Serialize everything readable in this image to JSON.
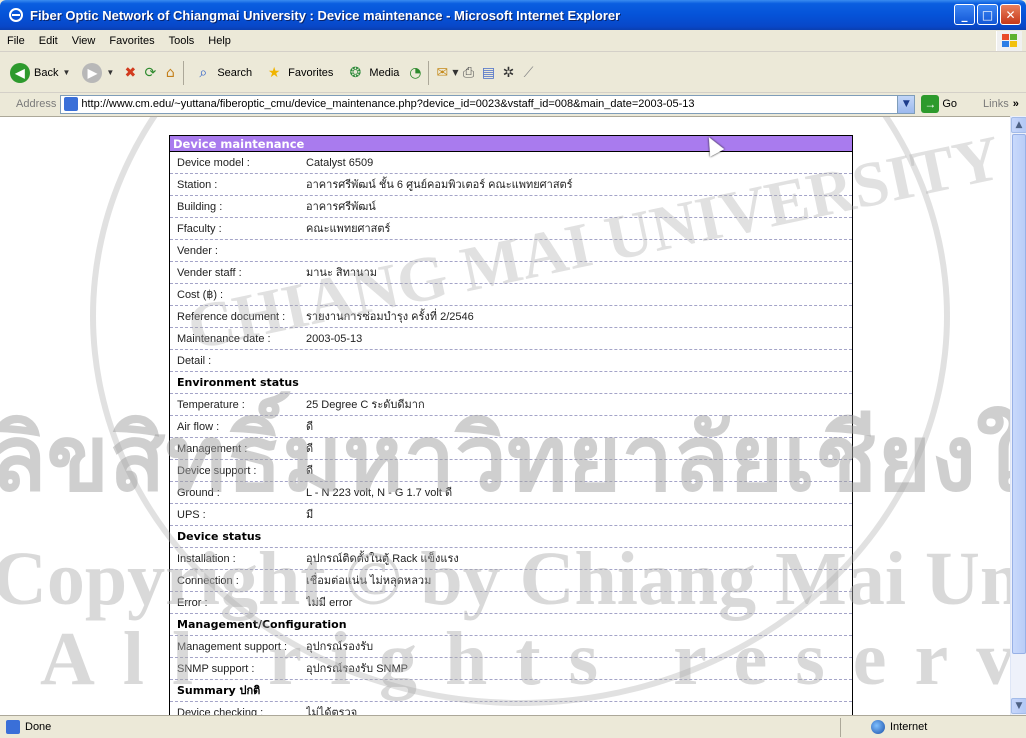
{
  "window": {
    "title": "Fiber Optic Network of Chiangmai University : Device maintenance - Microsoft Internet Explorer"
  },
  "menu": [
    "File",
    "Edit",
    "View",
    "Favorites",
    "Tools",
    "Help"
  ],
  "toolbar": {
    "back": "Back",
    "search": "Search",
    "favorites": "Favorites",
    "media": "Media"
  },
  "address": {
    "label": "Address",
    "url": "http://www.cm.edu/~yuttana/fiberoptic_cmu/device_maintenance.php?device_id=0023&vstaff_id=008&main_date=2003-05-13",
    "go": "Go",
    "links": "Links"
  },
  "panel": {
    "title": "Device maintenance",
    "rows_top": [
      {
        "label": "Device model :",
        "value": "Catalyst 6509"
      },
      {
        "label": "Station :",
        "value": "อาคารศรีพัฒน์ ชั้น 6 ศูนย์คอมพิวเตอร์ คณะแพทยศาสตร์"
      },
      {
        "label": "Building :",
        "value": "อาคารศรีพัฒน์"
      },
      {
        "label": "Ffaculty :",
        "value": "คณะแพทยศาสตร์"
      },
      {
        "label": "Vender :",
        "value": ""
      },
      {
        "label": "Vender staff :",
        "value": "มานะ สิทานาม"
      },
      {
        "label": "Cost (฿) :",
        "value": ""
      },
      {
        "label": "Reference document :",
        "value": "รายงานการซ่อมบำรุง ครั้งที่ 2/2546"
      },
      {
        "label": "Maintenance date :",
        "value": "2003-05-13"
      },
      {
        "label": "Detail :",
        "value": ""
      }
    ],
    "section_env": "Environment status",
    "rows_env": [
      {
        "label": "Temperature :",
        "value": "25 Degree C ระดับดีมาก"
      },
      {
        "label": "Air flow :",
        "value": "ดี"
      },
      {
        "label": "Management :",
        "value": "ดี"
      },
      {
        "label": "Device support :",
        "value": "ดี"
      },
      {
        "label": "Ground :",
        "value": "L - N 223 volt,  N - G 1.7 volt    ดี"
      },
      {
        "label": "UPS :",
        "value": "มี"
      }
    ],
    "section_dev": "Device status",
    "rows_dev": [
      {
        "label": "Installation :",
        "value": "อุปกรณ์ติดตั้งในตู้ Rack แข็งแรง"
      },
      {
        "label": "Connection :",
        "value": "เชื่อมต่อแน่น ไม่หลุดหลวม"
      },
      {
        "label": "Error :",
        "value": "ไม่มี error"
      }
    ],
    "section_mgmt": "Management/Configuration",
    "rows_mgmt": [
      {
        "label": "Management support :",
        "value": "อุปกรณ์รองรับ"
      },
      {
        "label": "SNMP support :",
        "value": "อุปกรณ์รองรับ SNMP"
      }
    ],
    "section_summary": "Summary    ปกติ",
    "rows_summary": [
      {
        "label": "Device checking :",
        "value": "ไม่ได้ตรวจ"
      }
    ]
  },
  "watermark": {
    "line1": "ลิขสิทธิ์มหาวิทยาลัยเชียงใหม่",
    "line2": "Copyright © by Chiang Mai University",
    "line3": "All rights reserved",
    "arc": "CHIANG MAI UNIVERSITY"
  },
  "status": {
    "left": "Done",
    "zone": "Internet"
  }
}
